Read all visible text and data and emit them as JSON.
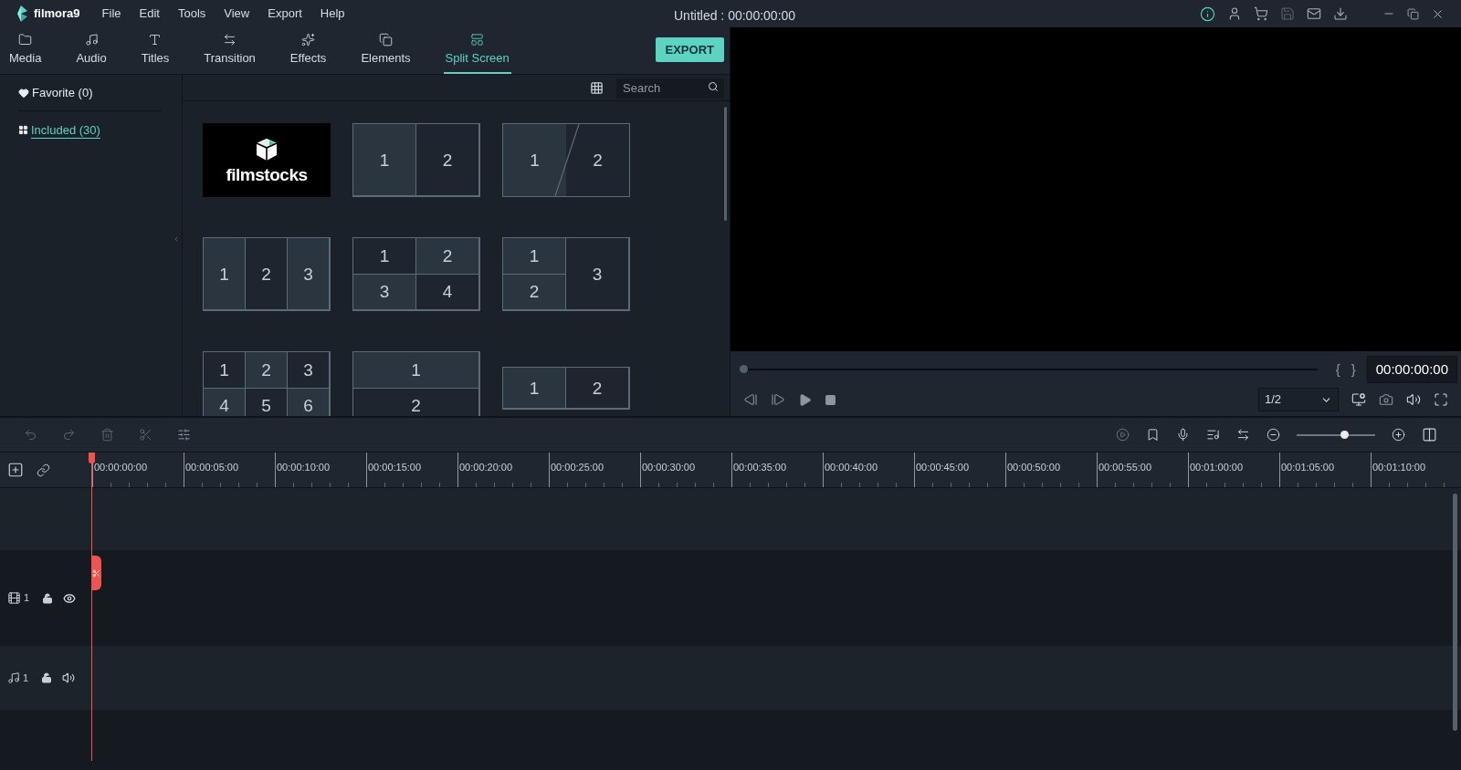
{
  "app": {
    "logo": "filmora9"
  },
  "menu": [
    "File",
    "Edit",
    "Tools",
    "View",
    "Export",
    "Help"
  ],
  "window": {
    "title": "Untitled : 00:00:00:00"
  },
  "tabs": [
    {
      "label": "Media",
      "selected": false
    },
    {
      "label": "Audio",
      "selected": false
    },
    {
      "label": "Titles",
      "selected": false
    },
    {
      "label": "Transition",
      "selected": false
    },
    {
      "label": "Effects",
      "selected": false
    },
    {
      "label": "Elements",
      "selected": false
    },
    {
      "label": "Split Screen",
      "selected": true
    }
  ],
  "export_button": "EXPORT",
  "sidebar": {
    "items": [
      {
        "label": "Favorite (0)",
        "selected": false
      },
      {
        "label": "Included (30)",
        "selected": true
      }
    ]
  },
  "search": {
    "placeholder": "Search"
  },
  "tiles": [
    {
      "kind": "logo",
      "text": "filmstocks"
    },
    {
      "kind": "split-2",
      "cells": [
        "1",
        "2"
      ]
    },
    {
      "kind": "diagonal-2",
      "cells": [
        "1",
        "2"
      ]
    },
    {
      "kind": "split-3",
      "cells": [
        "1",
        "2",
        "3"
      ]
    },
    {
      "kind": "quad",
      "cells": [
        "1",
        "2",
        "3",
        "4"
      ]
    },
    {
      "kind": "left-stack",
      "cells": [
        "1",
        "2",
        "3"
      ]
    },
    {
      "kind": "six",
      "cells": [
        "1",
        "2",
        "3",
        "4",
        "5",
        "6"
      ]
    },
    {
      "kind": "rows-2",
      "cells": [
        "1",
        "2"
      ]
    },
    {
      "kind": "split-2-short",
      "cells": [
        "1",
        "2"
      ]
    }
  ],
  "preview": {
    "progress": {
      "level": 0
    },
    "marks": [
      "{",
      "}"
    ],
    "timecode": "00:00:00:00",
    "quality": "1/2"
  },
  "timeline": {
    "zoom": {
      "level": 0.6
    },
    "ruler": [
      "00:00:00:00",
      "00:00:05:00",
      "00:00:10:00",
      "00:00:15:00",
      "00:00:20:00",
      "00:00:25:00",
      "00:00:30:00",
      "00:00:35:00",
      "00:00:40:00",
      "00:00:45:00",
      "00:00:50:00",
      "00:00:55:00",
      "00:01:00:00",
      "00:01:05:00",
      "00:01:10:00"
    ],
    "tracks": [
      {
        "kind": "video",
        "number": "1"
      },
      {
        "kind": "audio",
        "number": "1"
      }
    ]
  }
}
